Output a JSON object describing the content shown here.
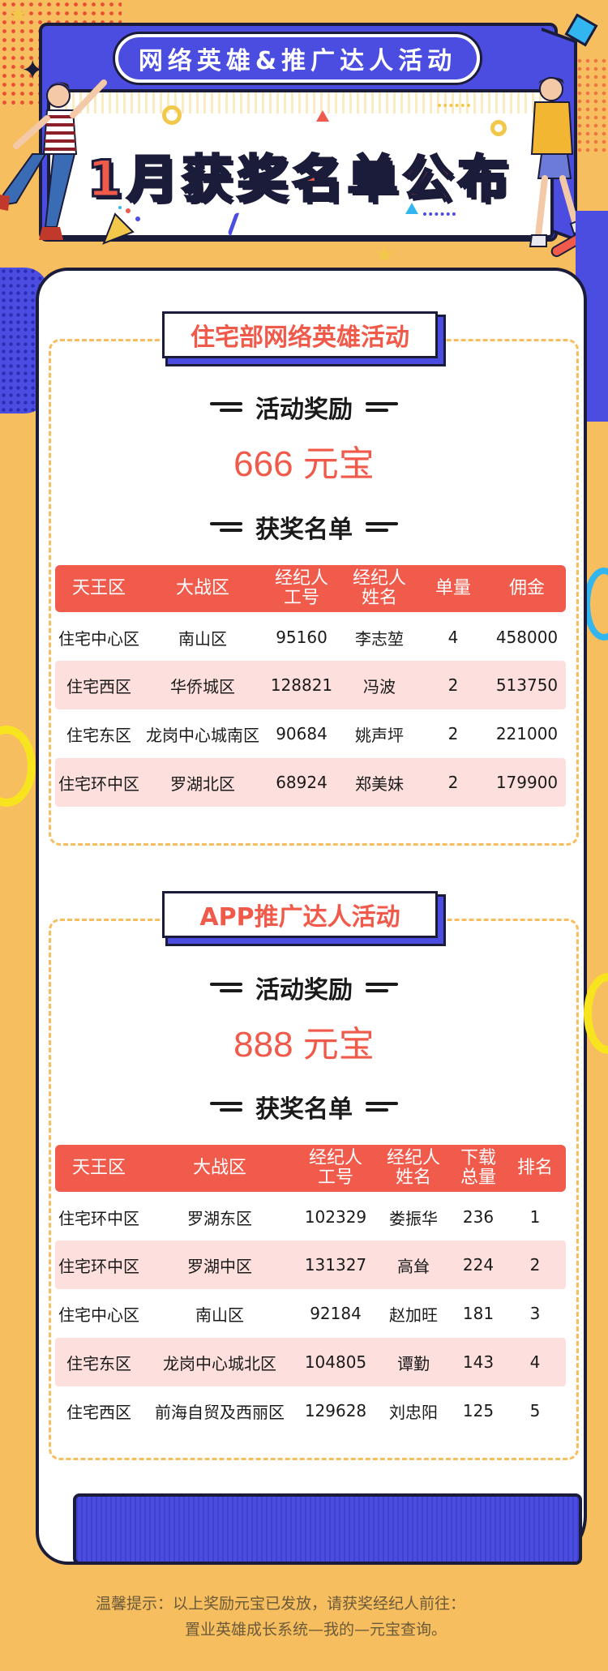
{
  "header": {
    "pill_text": "网络英雄&推广达人活动",
    "title": "1月获奖名单公布"
  },
  "section1": {
    "title": "住宅部网络英雄活动",
    "reward_label": "活动奖励",
    "reward_value": "666 元宝",
    "list_label": "获奖名单",
    "columns": [
      "天王区",
      "大战区",
      "经纪人\n工号",
      "经纪人\n姓名",
      "单量",
      "佣金"
    ],
    "rows": [
      [
        "住宅中心区",
        "南山区",
        "95160",
        "李志堃",
        "4",
        "458000"
      ],
      [
        "住宅西区",
        "华侨城区",
        "128821",
        "冯波",
        "2",
        "513750"
      ],
      [
        "住宅东区",
        "龙岗中心城南区",
        "90684",
        "姚声坪",
        "2",
        "221000"
      ],
      [
        "住宅环中区",
        "罗湖北区",
        "68924",
        "郑美妹",
        "2",
        "179900"
      ]
    ]
  },
  "section2": {
    "title": "APP推广达人活动",
    "reward_label": "活动奖励",
    "reward_value": "888 元宝",
    "list_label": "获奖名单",
    "columns": [
      "天王区",
      "大战区",
      "经纪人\n工号",
      "经纪人\n姓名",
      "下载\n总量",
      "排名"
    ],
    "rows": [
      [
        "住宅环中区",
        "罗湖东区",
        "102329",
        "娄振华",
        "236",
        "1"
      ],
      [
        "住宅环中区",
        "罗湖中区",
        "131327",
        "高耸",
        "224",
        "2"
      ],
      [
        "住宅中心区",
        "南山区",
        "92184",
        "赵加旺",
        "181",
        "3"
      ],
      [
        "住宅东区",
        "龙岗中心城北区",
        "104805",
        "谭勤",
        "143",
        "4"
      ],
      [
        "住宅西区",
        "前海自贸及西丽区",
        "129628",
        "刘忠阳",
        "125",
        "5"
      ]
    ]
  },
  "footer": {
    "tip_line1": "温馨提示：以上奖励元宝已发放，请获奖经纪人前往：",
    "tip_line2": "置业英雄成长系统—我的—元宝查询。"
  },
  "colors": {
    "background": "#F7BE5F",
    "accent_red": "#F05A4A",
    "accent_blue": "#4B4DE0",
    "row_highlight": "#FDE0DD"
  }
}
